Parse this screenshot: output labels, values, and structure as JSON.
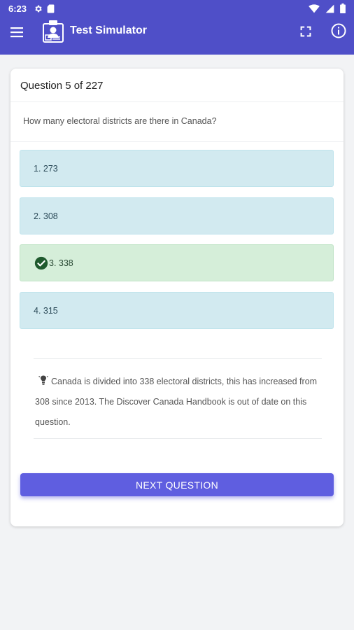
{
  "status": {
    "time": "6:23"
  },
  "app": {
    "title": "Test Simulator"
  },
  "question": {
    "counter": "Question 5 of 227",
    "text": "How many electoral districts are there in Canada?"
  },
  "answers": [
    {
      "label": "1. 273",
      "state": "default"
    },
    {
      "label": "2. 308",
      "state": "default"
    },
    {
      "label": "3. 338",
      "state": "correct"
    },
    {
      "label": "4. 315",
      "state": "default"
    }
  ],
  "explanation": {
    "text": "Canada is divided into 338 electoral districts, this has increased from 308 since 2013. The Discover Canada Handbook is out of date on this question."
  },
  "next_button": {
    "label": "NEXT QUESTION"
  },
  "colors": {
    "appbar": "#4f4fc8",
    "answer_default": "#d2eaf0",
    "answer_correct": "#d5eed9",
    "check": "#1f5a2e",
    "button": "#5f5ee0"
  },
  "icons": [
    "settings-icon",
    "sd-card-icon",
    "wifi-icon",
    "battery-icon",
    "menu-icon",
    "app-logo-icon",
    "fullscreen-icon",
    "info-icon",
    "check-circle-icon",
    "lightbulb-icon"
  ]
}
